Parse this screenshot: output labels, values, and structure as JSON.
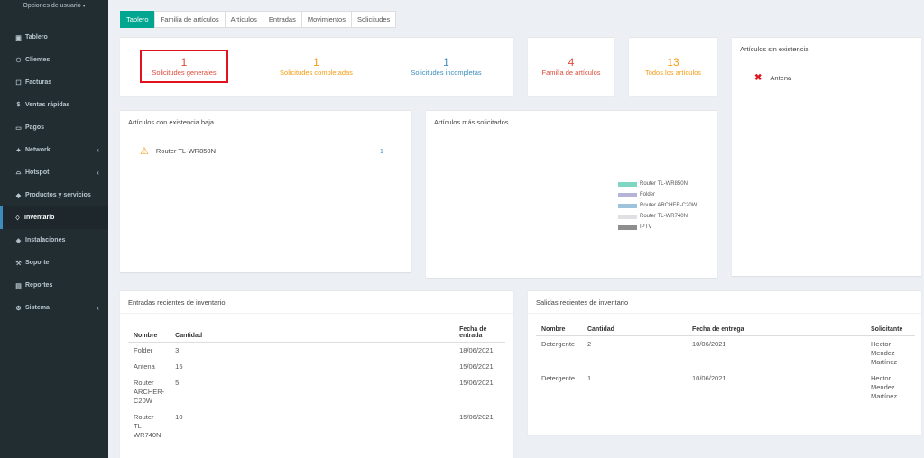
{
  "sidebar": {
    "user_menu": "Opciones de usuario",
    "items": [
      {
        "label": "Tablero",
        "icon": "dashboard-icon",
        "glyph": "▣",
        "has_submenu": false,
        "active": false
      },
      {
        "label": "Clientes",
        "icon": "users-icon",
        "glyph": "⚇",
        "has_submenu": false,
        "active": false
      },
      {
        "label": "Facturas",
        "icon": "file-icon",
        "glyph": "☐",
        "has_submenu": false,
        "active": false
      },
      {
        "label": "Ventas rápidas",
        "icon": "dollar-icon",
        "glyph": "$",
        "has_submenu": false,
        "active": false
      },
      {
        "label": "Pagos",
        "icon": "laptop-icon",
        "glyph": "▭",
        "has_submenu": false,
        "active": false
      },
      {
        "label": "Network",
        "icon": "network-icon",
        "glyph": "✦",
        "has_submenu": true,
        "active": false
      },
      {
        "label": "Hotspot",
        "icon": "wifi-icon",
        "glyph": "⌓",
        "has_submenu": true,
        "active": false
      },
      {
        "label": "Productos y servicios",
        "icon": "tags-icon",
        "glyph": "◆",
        "has_submenu": false,
        "active": false
      },
      {
        "label": "Inventario",
        "icon": "cubes-icon",
        "glyph": "♢",
        "has_submenu": false,
        "active": true
      },
      {
        "label": "Instalaciones",
        "icon": "tag-icon",
        "glyph": "◈",
        "has_submenu": false,
        "active": false
      },
      {
        "label": "Soporte",
        "icon": "wrench-icon",
        "glyph": "⚒",
        "has_submenu": false,
        "active": false
      },
      {
        "label": "Reportes",
        "icon": "book-icon",
        "glyph": "▤",
        "has_submenu": false,
        "active": false
      },
      {
        "label": "Sistema",
        "icon": "cogs-icon",
        "glyph": "⚙",
        "has_submenu": true,
        "active": false
      }
    ]
  },
  "tabs": [
    "Tablero",
    "Familia de artículos",
    "Artículos",
    "Entradas",
    "Movimientos",
    "Solicitudes"
  ],
  "stats": {
    "generales": {
      "num": "1",
      "label": "Solicitudes generales",
      "color": "#dd4b39"
    },
    "completadas": {
      "num": "1",
      "label": "Solicitudes completadas",
      "color": "#f39c12"
    },
    "incompletas": {
      "num": "1",
      "label": "Solicitudes incompletas",
      "color": "#3c8dbc"
    },
    "familia": {
      "num": "4",
      "label": "Familia de artículos",
      "color": "#dd4b39"
    },
    "todos": {
      "num": "13",
      "label": "Todos los artículos",
      "color": "#f39c12"
    }
  },
  "sin_existencia": {
    "title": "Artículos sin existencia",
    "items": [
      "Antena"
    ]
  },
  "existencia_baja": {
    "title": "Artículos con existencia baja",
    "items": [
      {
        "name": "Router TL-WR850N",
        "count": "1"
      }
    ]
  },
  "mas_solicitados": {
    "title": "Artículos más solicitados",
    "legend": [
      {
        "name": "Router TL-WR850N",
        "color": "#7fd6c2"
      },
      {
        "name": "Folder",
        "color": "#b6b3d8"
      },
      {
        "name": "Router ARCHER-C20W",
        "color": "#9fc3dd"
      },
      {
        "name": "Router TL-WR740N",
        "color": "#dfe0e3"
      },
      {
        "name": "IPTV",
        "color": "#8e8e8e"
      }
    ]
  },
  "entradas": {
    "title": "Entradas recientes de inventario",
    "headers": [
      "Nombre",
      "Cantidad",
      "Fecha de entrada"
    ],
    "rows": [
      [
        "Folder",
        "3",
        "18/06/2021"
      ],
      [
        "Antena",
        "15",
        "15/06/2021"
      ],
      [
        "Router ARCHER-C20W",
        "5",
        "15/06/2021"
      ],
      [
        "Router TL-WR740N",
        "10",
        "15/06/2021"
      ]
    ]
  },
  "salidas": {
    "title": "Salidas recientes de inventario",
    "headers": [
      "Nombre",
      "Cantidad",
      "Fecha de entrega",
      "Solicitante"
    ],
    "rows": [
      [
        "Detergente",
        "2",
        "10/06/2021",
        "Hector Mendez Martínez"
      ],
      [
        "Detergente",
        "1",
        "10/06/2021",
        "Hector Mendez Martínez"
      ]
    ]
  }
}
